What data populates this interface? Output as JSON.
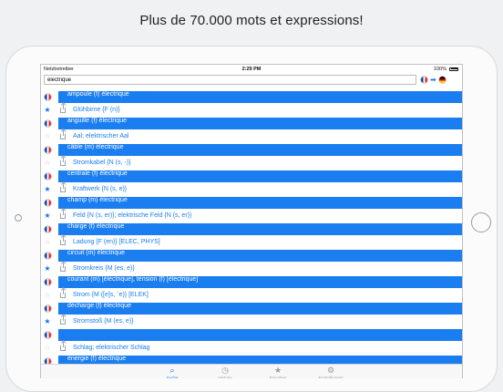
{
  "headline": "Plus de 70.000 mots et expressions!",
  "status": {
    "carrier": "Netzbetreiber",
    "time": "2:29 PM",
    "battery": "100%"
  },
  "search": {
    "value": "électrique"
  },
  "langs": {
    "from": "fr",
    "to": "de"
  },
  "rows": [
    {
      "kind": "fr",
      "text": "ampoule (f) électrique"
    },
    {
      "kind": "de",
      "starred": true,
      "text": "Glühbirne {F (n)}"
    },
    {
      "kind": "fr",
      "text": "anguille (f) électrique"
    },
    {
      "kind": "de",
      "starred": false,
      "text": "Aal; elektrischer Aal"
    },
    {
      "kind": "fr",
      "text": "câble (m) électrique"
    },
    {
      "kind": "de",
      "starred": false,
      "text": "Stromkabel {N (s, -)}"
    },
    {
      "kind": "fr",
      "text": "centrale (f) électrique"
    },
    {
      "kind": "de",
      "starred": true,
      "text": "Kraftwerk {N (s, e)}"
    },
    {
      "kind": "fr",
      "text": "champ (m) électrique"
    },
    {
      "kind": "de",
      "starred": true,
      "text": "Feld {N (s, er)}; elektrische Feld {N (s, er)}"
    },
    {
      "kind": "fr",
      "text": "charge (f) électrique"
    },
    {
      "kind": "de",
      "starred": false,
      "text": "Ladung {F (en)} [ELEC, PHYS]"
    },
    {
      "kind": "fr",
      "text": "circuit (m) électrique"
    },
    {
      "kind": "de",
      "starred": true,
      "text": "Stromkreis {M (es, e)}"
    },
    {
      "kind": "fr",
      "text": "courant (m) [électrique], tension (f) [électrique]"
    },
    {
      "kind": "de",
      "starred": false,
      "text": "Strom {M ([e]s, ¨e)} [ELEK]"
    },
    {
      "kind": "fr",
      "text": "décharge (f) électrique"
    },
    {
      "kind": "de",
      "starred": true,
      "text": "Stromstoß {M (es, e)}"
    },
    {
      "kind": "fr",
      "text": ""
    },
    {
      "kind": "de",
      "starred": false,
      "text": "Schlag; elektrischer Schlag"
    },
    {
      "kind": "fr",
      "text": "énergie (f) électrique"
    }
  ],
  "tabs": [
    {
      "label": "Suche",
      "icon": "search-icon",
      "active": true
    },
    {
      "label": "Historie",
      "icon": "clock-icon",
      "active": false
    },
    {
      "label": "Favoriten",
      "icon": "star-icon",
      "active": false
    },
    {
      "label": "Einstellungen",
      "icon": "gear-icon",
      "active": false
    }
  ]
}
